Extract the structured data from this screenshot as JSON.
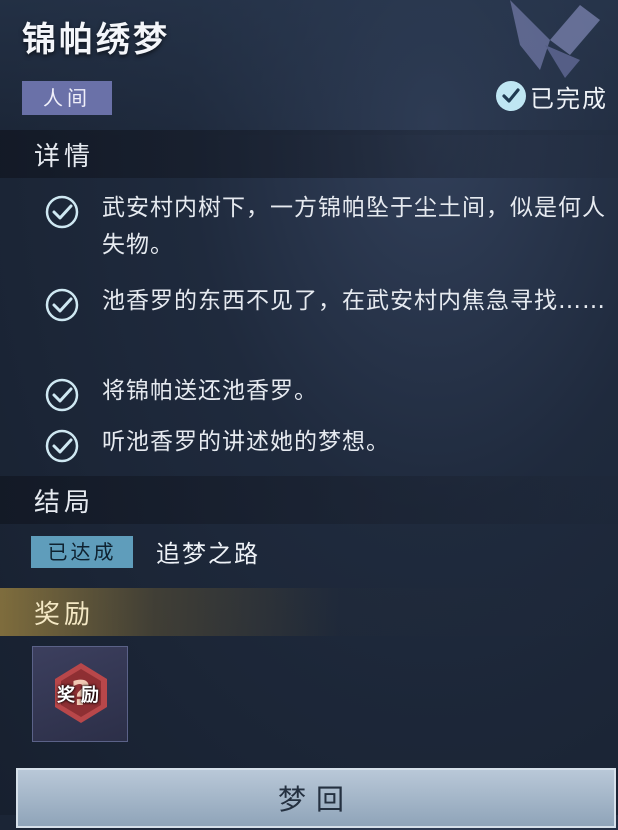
{
  "quest": {
    "title": "锦帕绣梦",
    "category": "人间",
    "status": "已完成"
  },
  "details": {
    "heading": "详情",
    "tasks": [
      {
        "text": "武安村内树下，一方锦帕坠于尘土间，似是何人失物。",
        "done": true
      },
      {
        "text": "池香罗的东西不见了，在武安村内焦急寻找……",
        "done": true
      },
      {
        "text": "将锦帕送还池香罗。",
        "done": true
      },
      {
        "text": "听池香罗的讲述她的梦想。",
        "done": true
      }
    ]
  },
  "ending": {
    "heading": "结局",
    "status_tag": "已达成",
    "name": "追梦之路"
  },
  "reward": {
    "heading": "奖励",
    "item_label": "奖励"
  },
  "actions": {
    "dream_button": "梦回"
  },
  "colors": {
    "realm_tag": "#6a71a8",
    "check": "#bfe6f3",
    "ending_tag": "#5f9dbb",
    "reward_gold": "#d2aa46"
  }
}
